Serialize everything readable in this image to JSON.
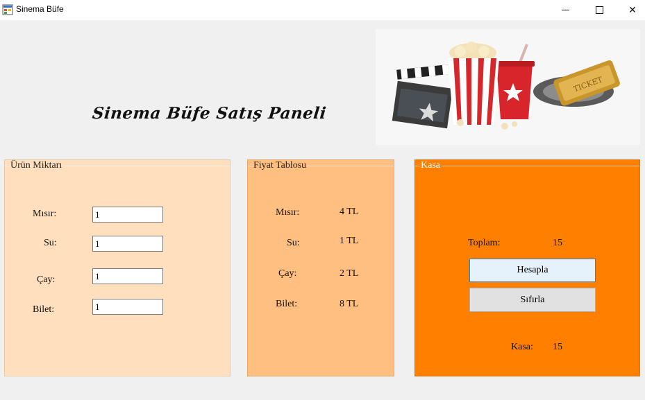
{
  "window": {
    "title": "Sinema Büfe",
    "min_glyph": "",
    "max_glyph": "",
    "close_glyph": "✕"
  },
  "heading": "Sinema  Büfe Satış Paneli",
  "urun_miktari": {
    "title": "Ürün Miktarı",
    "items": [
      {
        "label": "Mısır:",
        "value": "1"
      },
      {
        "label": "Su:",
        "value": "1"
      },
      {
        "label": "Çay:",
        "value": "1"
      },
      {
        "label": "Bilet:",
        "value": "1"
      }
    ]
  },
  "fiyat_tablosu": {
    "title": "Fiyat Tablosu",
    "items": [
      {
        "label": "Mısır:",
        "price": "4 TL"
      },
      {
        "label": "Su:",
        "price": "1 TL"
      },
      {
        "label": "Çay:",
        "price": "2 TL"
      },
      {
        "label": "Bilet:",
        "price": "8 TL"
      }
    ]
  },
  "kasa": {
    "title": "Kasa",
    "toplam_label": "Toplam:",
    "toplam_value": "15",
    "hesapla_label": "Hesapla",
    "sifirla_label": "Sıfırla",
    "kasa_label": "Kasa:",
    "kasa_value": "15"
  },
  "banner": {
    "ticket_text": "TICKET"
  },
  "colors": {
    "panel1": "#ffdfbd",
    "panel2": "#ffbf80",
    "panel3": "#ff8000"
  }
}
